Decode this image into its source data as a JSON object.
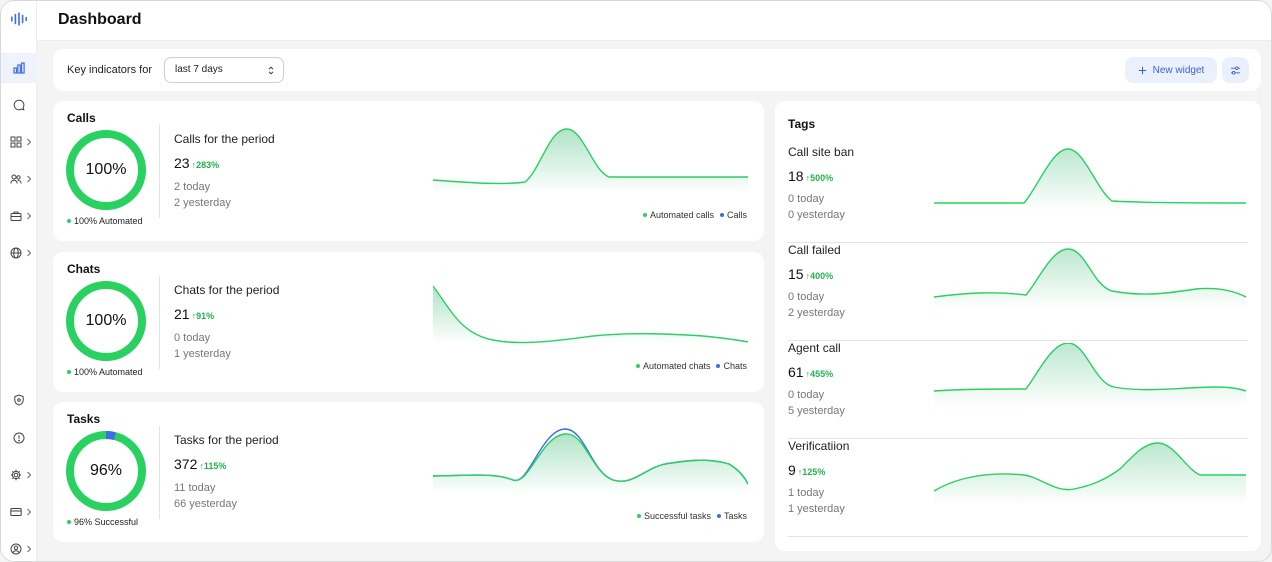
{
  "header": {
    "title": "Dashboard"
  },
  "filters": {
    "label": "Key indicators for",
    "period": "last 7 days"
  },
  "actions": {
    "new_widget": "New widget"
  },
  "colors": {
    "green": "#28d160",
    "blue": "#3d6ee8",
    "accent_text": "#3b63d8",
    "increase": "#22b34c"
  },
  "sidebar": {
    "items": [
      {
        "icon": "bar-chart-icon",
        "active": true
      },
      {
        "icon": "chat-bubble-icon"
      },
      {
        "icon": "grid-icon",
        "chevron": true
      },
      {
        "icon": "users-icon",
        "chevron": true
      },
      {
        "icon": "briefcase-icon",
        "chevron": true
      },
      {
        "icon": "globe-icon",
        "chevron": true
      },
      {
        "icon": "shield-icon"
      },
      {
        "icon": "help-icon"
      },
      {
        "icon": "gear-icon",
        "chevron": true
      },
      {
        "icon": "credit-card-icon",
        "chevron": true
      },
      {
        "icon": "user-circle-icon",
        "chevron": true
      }
    ]
  },
  "cards": [
    {
      "title": "Calls",
      "ring_label": "100%",
      "ring_fraction_green": 1.0,
      "ring_fraction_blue": 0.0,
      "caption": "100% Automated",
      "period_label": "Calls for the period",
      "count": "23",
      "change": "283%",
      "today": "2 today",
      "yesterday": "2 yesterday",
      "legend": [
        "Automated calls",
        "Calls"
      ]
    },
    {
      "title": "Chats",
      "ring_label": "100%",
      "ring_fraction_green": 1.0,
      "ring_fraction_blue": 0.0,
      "caption": "100% Automated",
      "period_label": "Chats for the period",
      "count": "21",
      "change": "91%",
      "today": "0 today",
      "yesterday": "1 yesterday",
      "legend": [
        "Automated chats",
        "Chats"
      ]
    },
    {
      "title": "Tasks",
      "ring_label": "96%",
      "ring_fraction_green": 0.96,
      "ring_fraction_blue": 0.04,
      "caption": "96% Successful",
      "period_label": "Tasks for the period",
      "count": "372",
      "change": "115%",
      "today": "11 today",
      "yesterday": "66 yesterday",
      "legend": [
        "Successful tasks",
        "Tasks"
      ]
    }
  ],
  "tags": {
    "title": "Tags",
    "items": [
      {
        "name": "Call site ban",
        "count": "18",
        "change": "500%",
        "today": "0 today",
        "yesterday": "0 yesterday"
      },
      {
        "name": "Call failed",
        "count": "15",
        "change": "400%",
        "today": "0 today",
        "yesterday": "2 yesterday"
      },
      {
        "name": "Agent call",
        "count": "61",
        "change": "455%",
        "today": "0 today",
        "yesterday": "5 yesterday"
      },
      {
        "name": "Verificatiion",
        "count": "9",
        "change": "125%",
        "today": "1 today",
        "yesterday": "1 yesterday"
      }
    ]
  }
}
